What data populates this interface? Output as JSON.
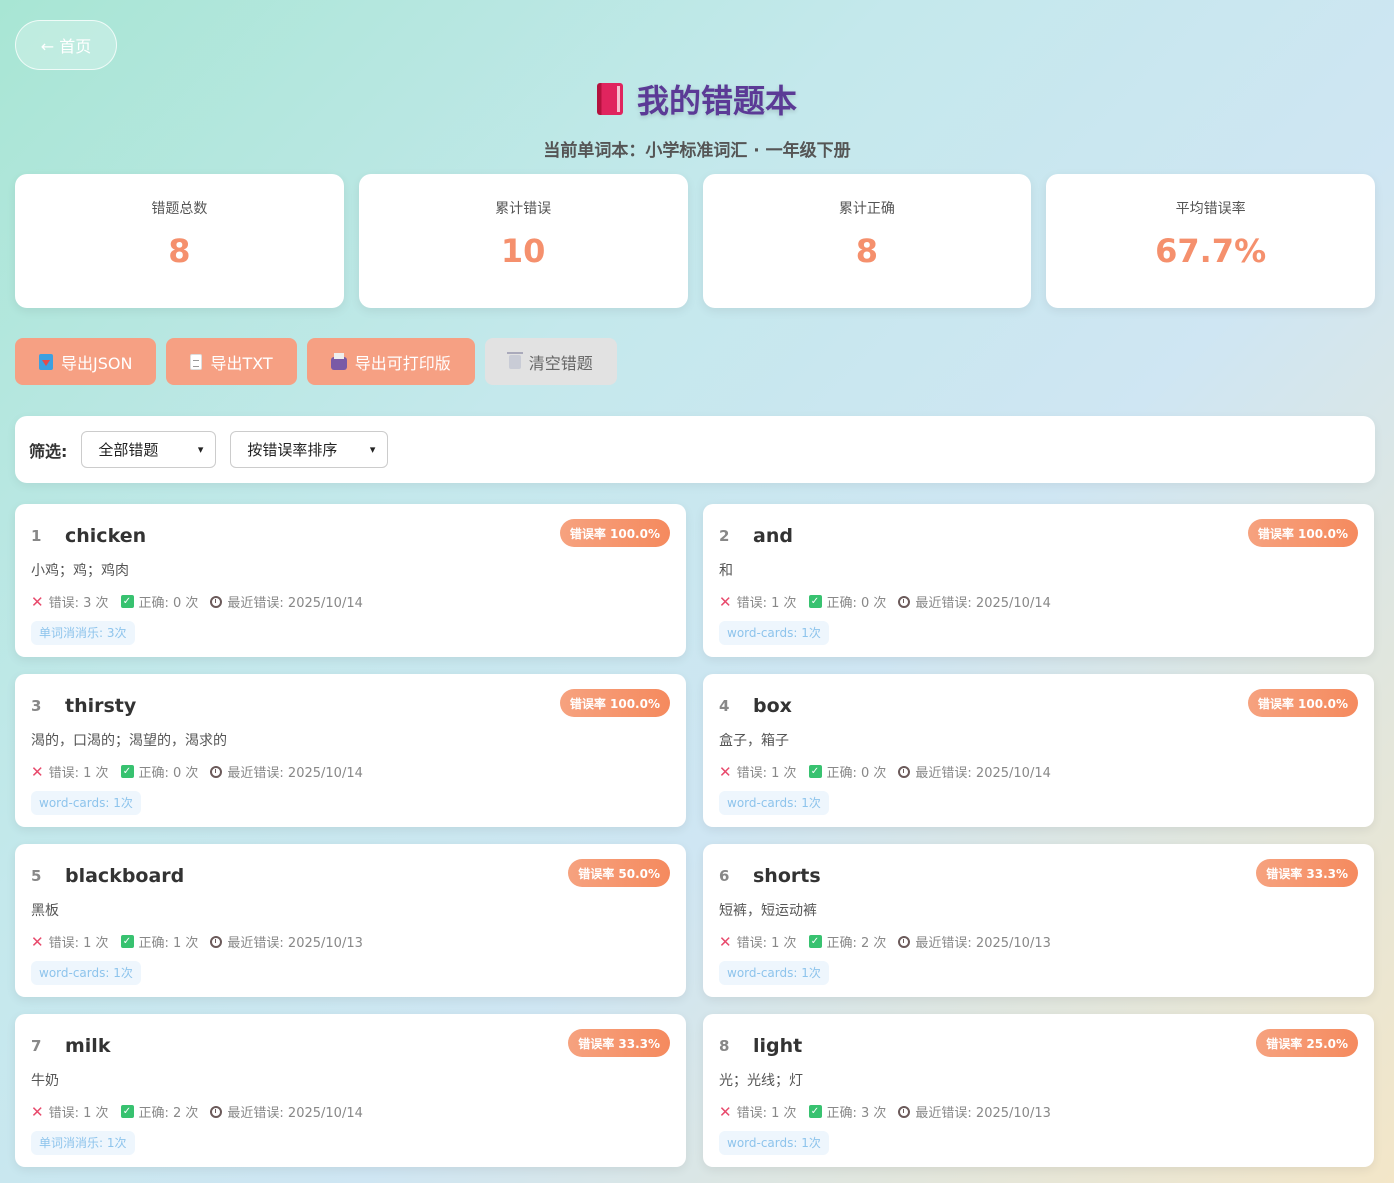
{
  "nav": {
    "home_label": "← 首页"
  },
  "header": {
    "title": "我的错题本",
    "icon": "closed-book-icon",
    "subtitle": "当前单词本：小学标准词汇 · 一年级下册"
  },
  "stats": [
    {
      "label": "错题总数",
      "value": "8"
    },
    {
      "label": "累计错误",
      "value": "10"
    },
    {
      "label": "累计正确",
      "value": "8"
    },
    {
      "label": "平均错误率",
      "value": "67.7%"
    }
  ],
  "actions": {
    "export_json": "导出JSON",
    "export_txt": "导出TXT",
    "export_print": "导出可打印版",
    "clear": "清空错题"
  },
  "filter": {
    "label": "筛选:",
    "filter_selected": "全部错题",
    "sort_selected": "按错误率排序"
  },
  "colors": {
    "accent": "#f5906d",
    "title": "#5b3a96",
    "badge": "#f58a5e"
  },
  "words": [
    {
      "idx": "1",
      "word": "chicken",
      "badge": "错误率 100.0%",
      "meaning": "小鸡；鸡；鸡肉",
      "wrong": "错误: 3 次",
      "right": "正确: 0 次",
      "last": "最近错误: 2025/10/14",
      "tag": "单词消消乐: 3次"
    },
    {
      "idx": "2",
      "word": "and",
      "badge": "错误率 100.0%",
      "meaning": "和",
      "wrong": "错误: 1 次",
      "right": "正确: 0 次",
      "last": "最近错误: 2025/10/14",
      "tag": "word-cards: 1次"
    },
    {
      "idx": "3",
      "word": "thirsty",
      "badge": "错误率 100.0%",
      "meaning": "渴的，口渴的；渴望的，渴求的",
      "wrong": "错误: 1 次",
      "right": "正确: 0 次",
      "last": "最近错误: 2025/10/14",
      "tag": "word-cards: 1次"
    },
    {
      "idx": "4",
      "word": "box",
      "badge": "错误率 100.0%",
      "meaning": "盒子，箱子",
      "wrong": "错误: 1 次",
      "right": "正确: 0 次",
      "last": "最近错误: 2025/10/14",
      "tag": "word-cards: 1次"
    },
    {
      "idx": "5",
      "word": "blackboard",
      "badge": "错误率 50.0%",
      "meaning": "黑板",
      "wrong": "错误: 1 次",
      "right": "正确: 1 次",
      "last": "最近错误: 2025/10/13",
      "tag": "word-cards: 1次"
    },
    {
      "idx": "6",
      "word": "shorts",
      "badge": "错误率 33.3%",
      "meaning": "短裤，短运动裤",
      "wrong": "错误: 1 次",
      "right": "正确: 2 次",
      "last": "最近错误: 2025/10/13",
      "tag": "word-cards: 1次"
    },
    {
      "idx": "7",
      "word": "milk",
      "badge": "错误率 33.3%",
      "meaning": "牛奶",
      "wrong": "错误: 1 次",
      "right": "正确: 2 次",
      "last": "最近错误: 2025/10/14",
      "tag": "单词消消乐: 1次"
    },
    {
      "idx": "8",
      "word": "light",
      "badge": "错误率 25.0%",
      "meaning": "光；光线；灯",
      "wrong": "错误: 1 次",
      "right": "正确: 3 次",
      "last": "最近错误: 2025/10/13",
      "tag": "word-cards: 1次"
    }
  ]
}
